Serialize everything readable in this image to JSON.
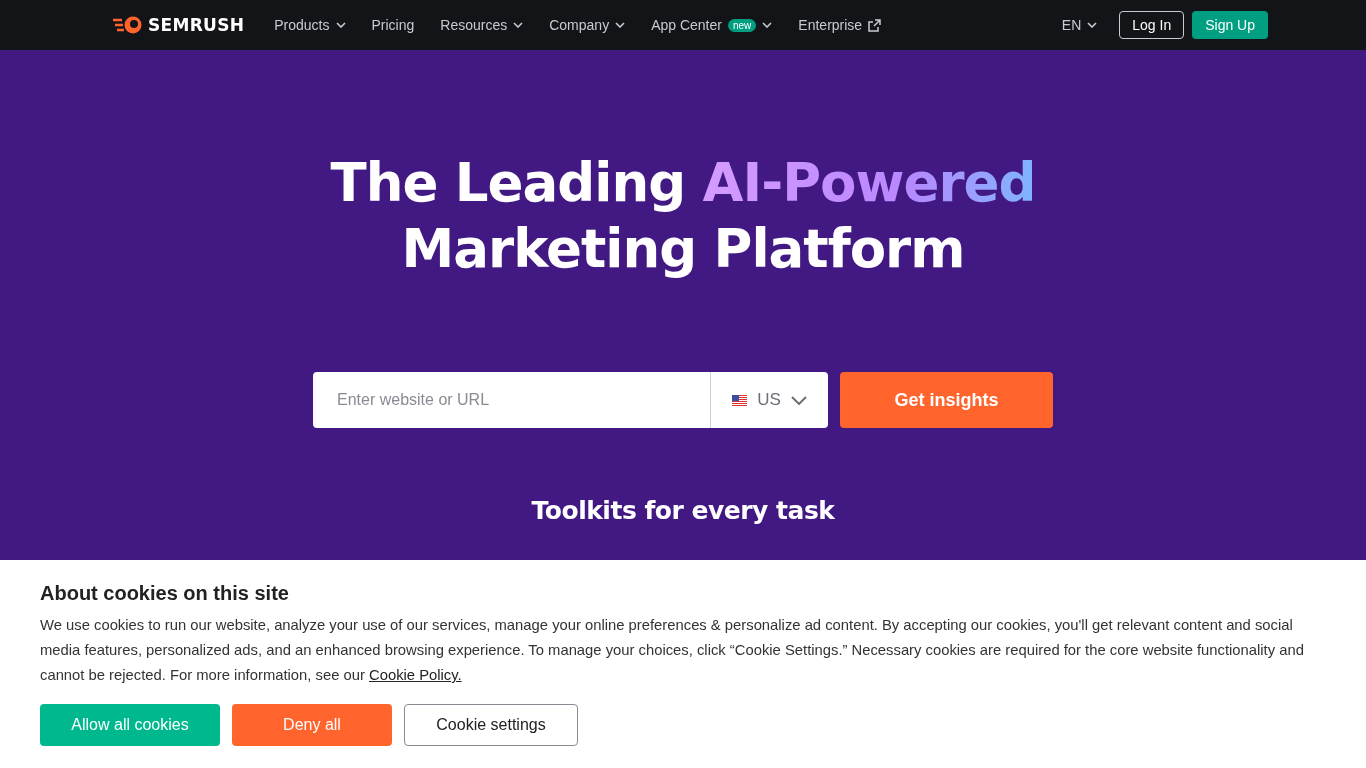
{
  "nav": {
    "logo": "SEMRUSH",
    "items": [
      {
        "label": "Products",
        "dropdown": true,
        "external": false
      },
      {
        "label": "Pricing",
        "dropdown": false,
        "external": false
      },
      {
        "label": "Resources",
        "dropdown": true,
        "external": false
      },
      {
        "label": "Company",
        "dropdown": true,
        "external": false
      },
      {
        "label": "App Center",
        "badge": "new",
        "dropdown": true,
        "external": false
      },
      {
        "label": "Enterprise",
        "dropdown": false,
        "external": true
      }
    ],
    "language": "EN",
    "login": "Log In",
    "signup": "Sign Up"
  },
  "hero": {
    "title_start": "The Leading ",
    "title_highlight": "AI-Powered",
    "title_end": "Marketing Platform",
    "search": {
      "placeholder": "Enter website or URL",
      "country": "US"
    },
    "submit": "Get insights",
    "subtitle": "Toolkits for every task"
  },
  "cookies": {
    "title": "About cookies on this site",
    "text": "We use cookies to run our website, analyze your use of our services, manage your online preferences & personalize ad content. By accepting our cookies, you'll get relevant content and social media features, personalized ads, and an enhanced browsing experience. To manage your choices, click “Cookie Settings.” Necessary cookies are required for the core website functionality and cannot be rejected. For more information, see our ",
    "link": "Cookie Policy.",
    "buttons": [
      {
        "label": "Allow all cookies",
        "kind": "accept"
      },
      {
        "label": "Deny all",
        "kind": "deny"
      },
      {
        "label": "Cookie settings",
        "kind": "settings"
      }
    ]
  }
}
